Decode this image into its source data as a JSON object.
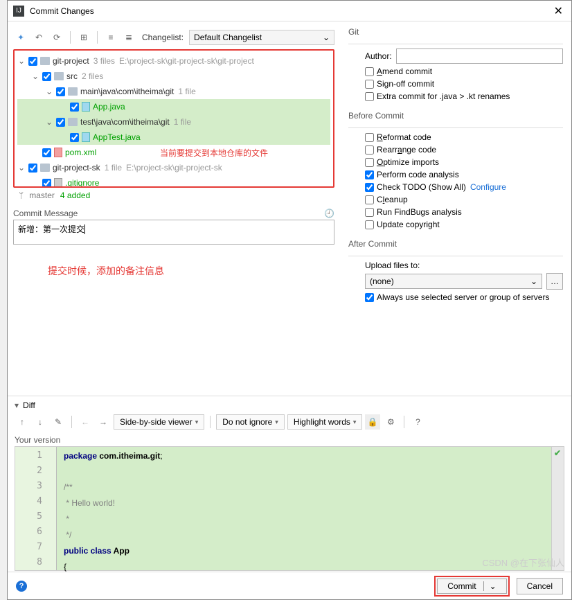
{
  "dialog": {
    "title": "Commit Changes"
  },
  "toolbar": {
    "changelist_label": "Changelist:",
    "changelist_value": "Default Changelist"
  },
  "tree": {
    "root1": {
      "name": "git-project",
      "meta1": "3 files",
      "meta2": "E:\\project-sk\\git-project-sk\\git-project"
    },
    "src": {
      "name": "src",
      "meta": "2 files"
    },
    "main": {
      "name": "main\\java\\com\\itheima\\git",
      "meta": "1 file"
    },
    "app": {
      "name": "App.java"
    },
    "test": {
      "name": "test\\java\\com\\itheima\\git",
      "meta": "1 file"
    },
    "apptest": {
      "name": "AppTest.java"
    },
    "pom": {
      "name": "pom.xml"
    },
    "root2": {
      "name": "git-project-sk",
      "meta1": "1 file",
      "meta2": "E:\\project-sk\\git-project-sk"
    },
    "gitignore": {
      "name": ".gitignore"
    },
    "red_note": "当前要提交到本地仓库的文件"
  },
  "branch": {
    "name": "master",
    "added": "4 added"
  },
  "commit_msg": {
    "label": "Commit Message",
    "value": "新增：第一次提交",
    "red_note": "提交时候，添加的备注信息"
  },
  "git": {
    "title": "Git",
    "author_label": "Author:",
    "author_value": "",
    "amend": "Amend commit",
    "signoff": "Sign-off commit",
    "extra": "Extra commit for .java > .kt renames"
  },
  "before": {
    "title": "Before Commit",
    "reformat": "Reformat code",
    "rearrange": "Rearrange code",
    "optimize": "Optimize imports",
    "analysis": "Perform code analysis",
    "todo": "Check TODO (Show All)",
    "configure": "Configure",
    "cleanup": "Cleanup",
    "findbugs": "Run FindBugs analysis",
    "copyright": "Update copyright"
  },
  "after": {
    "title": "After Commit",
    "upload_label": "Upload files to:",
    "upload_value": "(none)",
    "always": "Always use selected server or group of servers"
  },
  "diff": {
    "label": "Diff",
    "viewer": "Side-by-side viewer",
    "ignore": "Do not ignore",
    "highlight": "Highlight words",
    "your_version": "Your version"
  },
  "code": {
    "lines": [
      "1",
      "2",
      "3",
      "4",
      "5",
      "6",
      "7",
      "8"
    ],
    "l1a": "package ",
    "l1b": "com.itheima.git",
    "l1c": ";",
    "l3": "/**",
    "l4": " * Hello world!",
    "l5": " *",
    "l6": " */",
    "l7a": "public class ",
    "l7b": "App",
    "l8": "{"
  },
  "buttons": {
    "commit": "Commit",
    "cancel": "Cancel"
  },
  "watermark": "CSDN @在下张仙人"
}
